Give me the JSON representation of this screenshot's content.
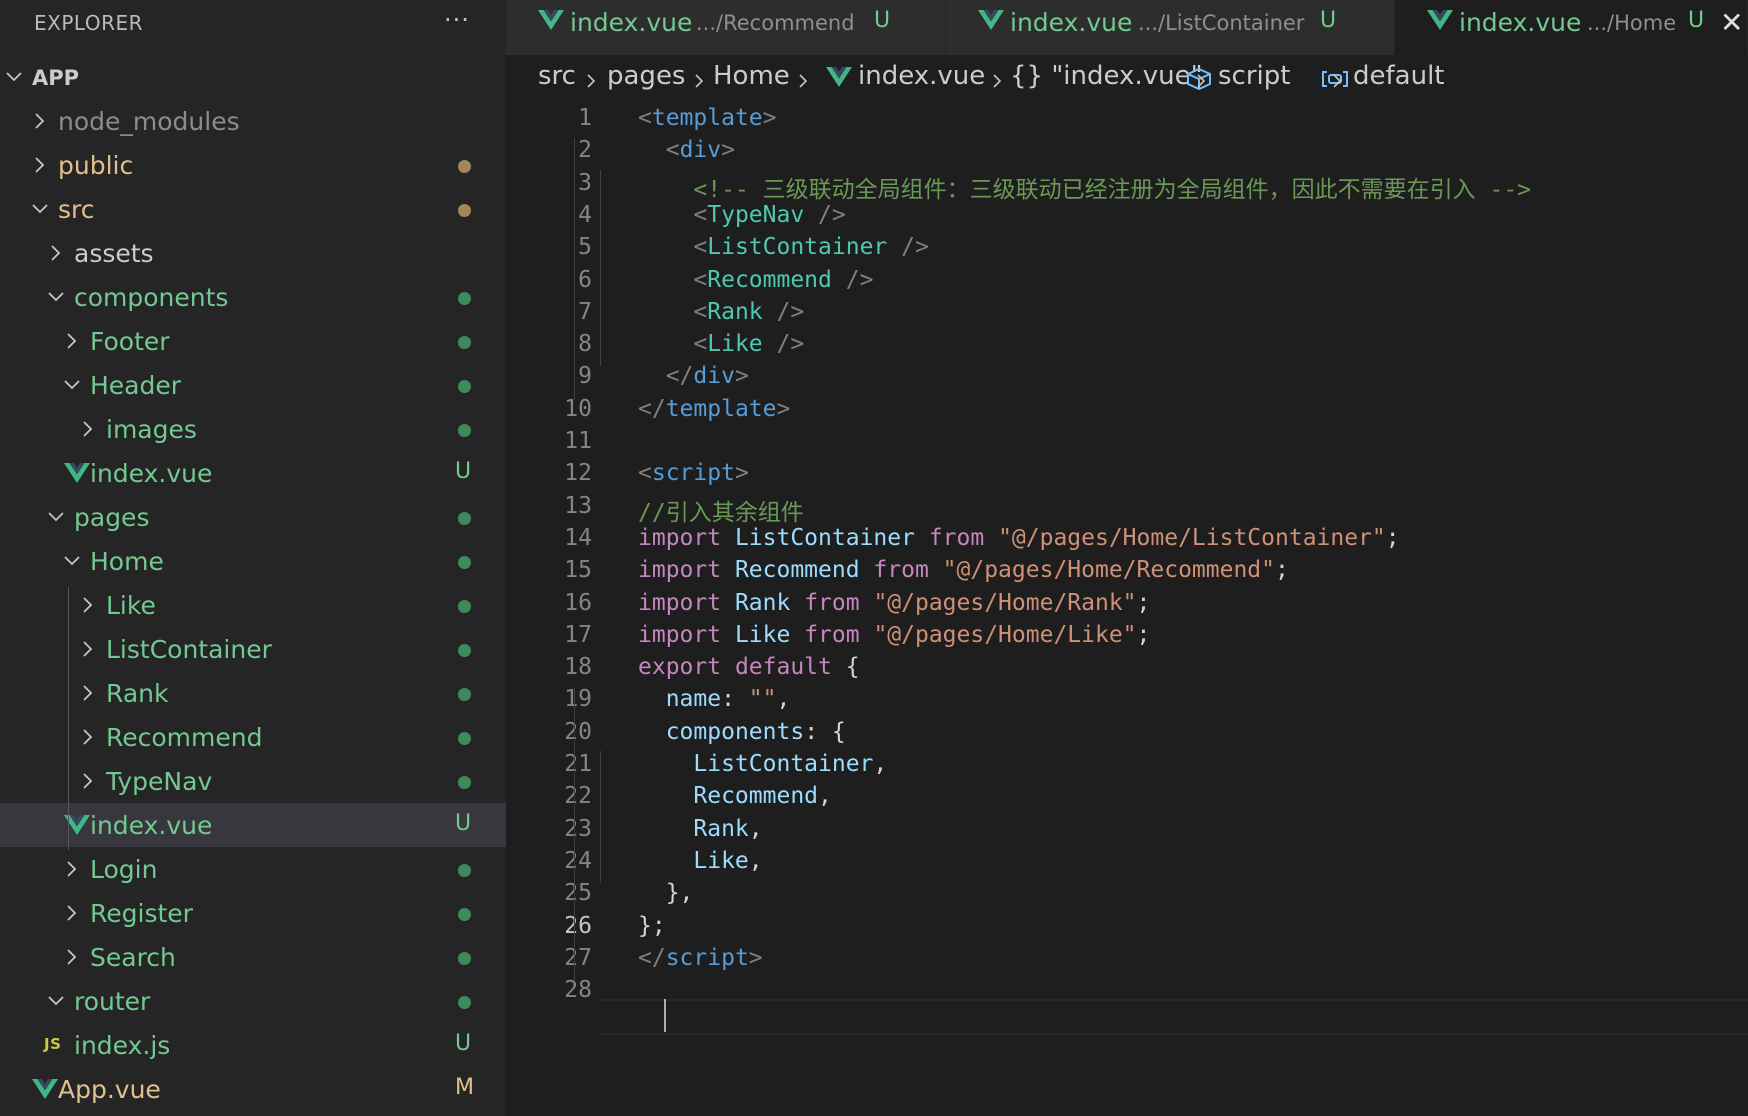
{
  "explorer": {
    "title": "EXPLORER",
    "more_icon": "ellipsis-icon",
    "tree": [
      {
        "label": "APP",
        "kind": "root",
        "chevron": "down",
        "status": "",
        "color": "#cccccc"
      },
      {
        "label": "node_modules",
        "kind": "folder",
        "chevron": "right",
        "status": "",
        "color": "#8c8c8c"
      },
      {
        "label": "public",
        "kind": "folder",
        "chevron": "right",
        "status": "dot",
        "color": "#e2c08d"
      },
      {
        "label": "src",
        "kind": "folder",
        "chevron": "down",
        "status": "dot",
        "color": "#e2c08d"
      },
      {
        "label": "assets",
        "kind": "folder",
        "chevron": "right",
        "status": "",
        "color": "#cccccc"
      },
      {
        "label": "components",
        "kind": "folder",
        "chevron": "down",
        "status": "dot",
        "color": "#73c991"
      },
      {
        "label": "Footer",
        "kind": "folder",
        "chevron": "right",
        "status": "dot",
        "color": "#73c991"
      },
      {
        "label": "Header",
        "kind": "folder",
        "chevron": "down",
        "status": "dot",
        "color": "#73c991"
      },
      {
        "label": "images",
        "kind": "folder",
        "chevron": "right",
        "status": "dot",
        "color": "#73c991"
      },
      {
        "label": "index.vue",
        "kind": "vue",
        "chevron": "",
        "status": "U",
        "color": "#73c991"
      },
      {
        "label": "pages",
        "kind": "folder",
        "chevron": "down",
        "status": "dot",
        "color": "#73c991"
      },
      {
        "label": "Home",
        "kind": "folder",
        "chevron": "down",
        "status": "dot",
        "color": "#73c991"
      },
      {
        "label": "Like",
        "kind": "folder",
        "chevron": "right",
        "status": "dot",
        "color": "#73c991"
      },
      {
        "label": "ListContainer",
        "kind": "folder",
        "chevron": "right",
        "status": "dot",
        "color": "#73c991"
      },
      {
        "label": "Rank",
        "kind": "folder",
        "chevron": "right",
        "status": "dot",
        "color": "#73c991"
      },
      {
        "label": "Recommend",
        "kind": "folder",
        "chevron": "right",
        "status": "dot",
        "color": "#73c991"
      },
      {
        "label": "TypeNav",
        "kind": "folder",
        "chevron": "right",
        "status": "dot",
        "color": "#73c991"
      },
      {
        "label": "index.vue",
        "kind": "vue",
        "chevron": "",
        "status": "U",
        "color": "#73c991",
        "selected": true
      },
      {
        "label": "Login",
        "kind": "folder",
        "chevron": "right",
        "status": "dot",
        "color": "#73c991"
      },
      {
        "label": "Register",
        "kind": "folder",
        "chevron": "right",
        "status": "dot",
        "color": "#73c991"
      },
      {
        "label": "Search",
        "kind": "folder",
        "chevron": "right",
        "status": "dot",
        "color": "#73c991"
      },
      {
        "label": "router",
        "kind": "folder",
        "chevron": "down",
        "status": "dot",
        "color": "#73c991"
      },
      {
        "label": "index.js",
        "kind": "js",
        "chevron": "",
        "status": "U",
        "color": "#73c991"
      },
      {
        "label": "App.vue",
        "kind": "vue",
        "chevron": "",
        "status": "M",
        "color": "#e2c08d"
      }
    ]
  },
  "tabs": [
    {
      "name": "index.vue",
      "path": ".../Recommend",
      "status": "U",
      "active": false
    },
    {
      "name": "index.vue",
      "path": ".../ListContainer",
      "status": "U",
      "active": false
    },
    {
      "name": "index.vue",
      "path": ".../Home",
      "status": "U",
      "active": true
    }
  ],
  "tab_close_glyph": "✕",
  "breadcrumb": {
    "items": [
      "src",
      "pages",
      "Home",
      "index.vue",
      "{} \"index.vue\"",
      "script",
      "default"
    ],
    "icons": [
      "",
      "",
      "",
      "vue-icon",
      "",
      "cube-icon",
      "variable-icon"
    ]
  },
  "editor": {
    "current_line": 26,
    "lines": [
      [
        [
          "<",
          "#808080"
        ],
        [
          "template",
          "#569cd6"
        ],
        [
          ">",
          "#808080"
        ]
      ],
      [
        [
          "  ",
          "#d4d4d4"
        ],
        [
          "<",
          "#808080"
        ],
        [
          "div",
          "#569cd6"
        ],
        [
          ">",
          "#808080"
        ]
      ],
      [
        [
          "    ",
          "#d4d4d4"
        ],
        [
          "<!-- 三级联动全局组件：三级联动已经注册为全局组件，因此不需要在引入 -->",
          "#6a9955"
        ]
      ],
      [
        [
          "    ",
          "#d4d4d4"
        ],
        [
          "<",
          "#808080"
        ],
        [
          "TypeNav",
          "#4ec9b0"
        ],
        [
          " />",
          "#808080"
        ]
      ],
      [
        [
          "    ",
          "#d4d4d4"
        ],
        [
          "<",
          "#808080"
        ],
        [
          "ListContainer",
          "#4ec9b0"
        ],
        [
          " />",
          "#808080"
        ]
      ],
      [
        [
          "    ",
          "#d4d4d4"
        ],
        [
          "<",
          "#808080"
        ],
        [
          "Recommend",
          "#4ec9b0"
        ],
        [
          " />",
          "#808080"
        ]
      ],
      [
        [
          "    ",
          "#d4d4d4"
        ],
        [
          "<",
          "#808080"
        ],
        [
          "Rank",
          "#4ec9b0"
        ],
        [
          " />",
          "#808080"
        ]
      ],
      [
        [
          "    ",
          "#d4d4d4"
        ],
        [
          "<",
          "#808080"
        ],
        [
          "Like",
          "#4ec9b0"
        ],
        [
          " />",
          "#808080"
        ]
      ],
      [
        [
          "  ",
          "#d4d4d4"
        ],
        [
          "</",
          "#808080"
        ],
        [
          "div",
          "#569cd6"
        ],
        [
          ">",
          "#808080"
        ]
      ],
      [
        [
          "</",
          "#808080"
        ],
        [
          "template",
          "#569cd6"
        ],
        [
          ">",
          "#808080"
        ]
      ],
      [],
      [
        [
          "<",
          "#808080"
        ],
        [
          "script",
          "#569cd6"
        ],
        [
          ">",
          "#808080"
        ]
      ],
      [
        [
          "//引入其余组件",
          "#6a9955"
        ]
      ],
      [
        [
          "import ",
          "#c586c0"
        ],
        [
          "ListContainer ",
          "#9cdcfe"
        ],
        [
          "from ",
          "#c586c0"
        ],
        [
          "\"@/pages/Home/ListContainer\"",
          "#ce9178"
        ],
        [
          ";",
          "#d4d4d4"
        ]
      ],
      [
        [
          "import ",
          "#c586c0"
        ],
        [
          "Recommend ",
          "#9cdcfe"
        ],
        [
          "from ",
          "#c586c0"
        ],
        [
          "\"@/pages/Home/Recommend\"",
          "#ce9178"
        ],
        [
          ";",
          "#d4d4d4"
        ]
      ],
      [
        [
          "import ",
          "#c586c0"
        ],
        [
          "Rank ",
          "#9cdcfe"
        ],
        [
          "from ",
          "#c586c0"
        ],
        [
          "\"@/pages/Home/Rank\"",
          "#ce9178"
        ],
        [
          ";",
          "#d4d4d4"
        ]
      ],
      [
        [
          "import ",
          "#c586c0"
        ],
        [
          "Like ",
          "#9cdcfe"
        ],
        [
          "from ",
          "#c586c0"
        ],
        [
          "\"@/pages/Home/Like\"",
          "#ce9178"
        ],
        [
          ";",
          "#d4d4d4"
        ]
      ],
      [
        [
          "export ",
          "#c586c0"
        ],
        [
          "default ",
          "#c586c0"
        ],
        [
          "{",
          "#d4d4d4"
        ]
      ],
      [
        [
          "  ",
          "#d4d4d4"
        ],
        [
          "name",
          "#9cdcfe"
        ],
        [
          ": ",
          "#d4d4d4"
        ],
        [
          "\"\"",
          "#ce9178"
        ],
        [
          ",",
          "#d4d4d4"
        ]
      ],
      [
        [
          "  ",
          "#d4d4d4"
        ],
        [
          "components",
          "#9cdcfe"
        ],
        [
          ": {",
          "#d4d4d4"
        ]
      ],
      [
        [
          "    ",
          "#d4d4d4"
        ],
        [
          "ListContainer",
          "#9cdcfe"
        ],
        [
          ",",
          "#d4d4d4"
        ]
      ],
      [
        [
          "    ",
          "#d4d4d4"
        ],
        [
          "Recommend",
          "#9cdcfe"
        ],
        [
          ",",
          "#d4d4d4"
        ]
      ],
      [
        [
          "    ",
          "#d4d4d4"
        ],
        [
          "Rank",
          "#9cdcfe"
        ],
        [
          ",",
          "#d4d4d4"
        ]
      ],
      [
        [
          "    ",
          "#d4d4d4"
        ],
        [
          "Like",
          "#9cdcfe"
        ],
        [
          ",",
          "#d4d4d4"
        ]
      ],
      [
        [
          "  ",
          "#d4d4d4"
        ],
        [
          "},",
          "#d4d4d4"
        ]
      ],
      [
        [
          "};",
          "#d4d4d4"
        ]
      ],
      [
        [
          "</",
          "#808080"
        ],
        [
          "script",
          "#569cd6"
        ],
        [
          ">",
          "#808080"
        ]
      ],
      []
    ]
  },
  "colors": {
    "sidebar_bg": "#252526",
    "editor_bg": "#1e1e1e",
    "untracked_green": "#73c991",
    "modified_yellow": "#e2c08d",
    "vue_green": "#41b883"
  }
}
